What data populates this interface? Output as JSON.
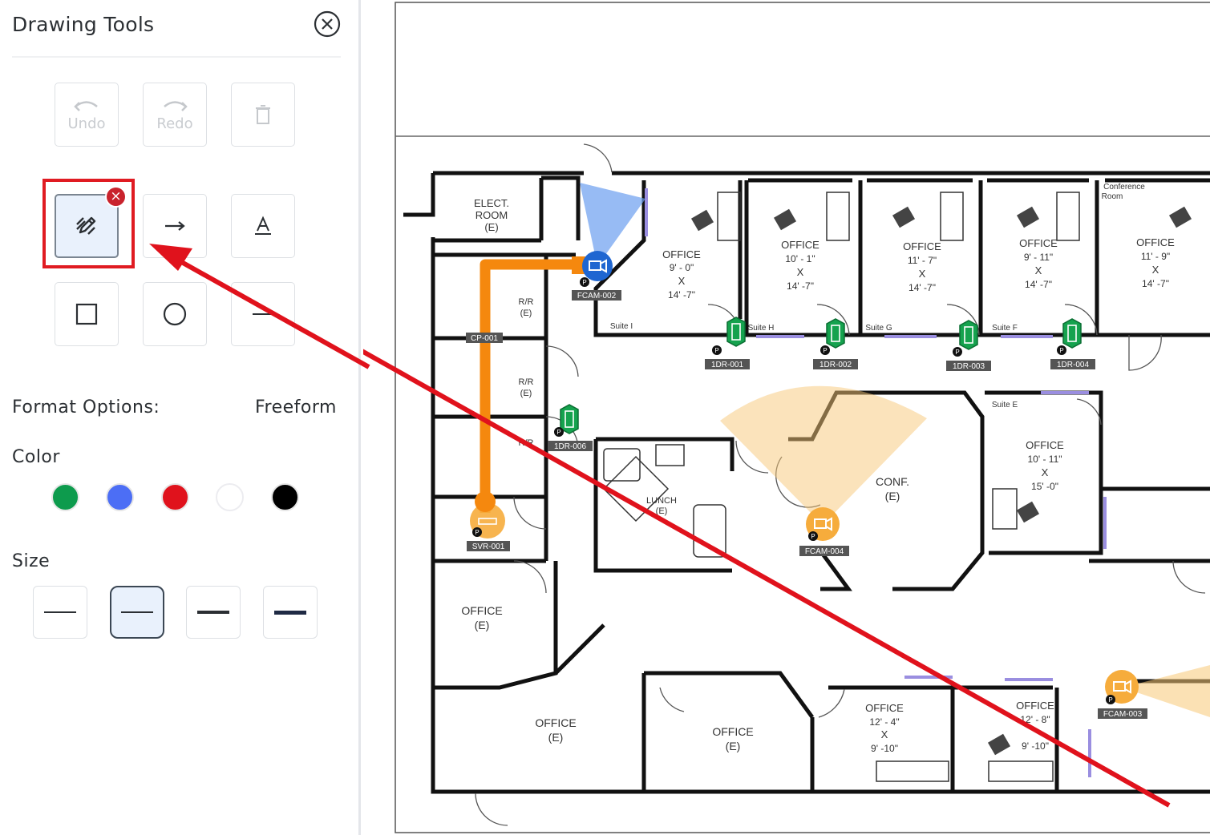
{
  "panel": {
    "title": "Drawing Tools",
    "undo_label": "Undo",
    "redo_label": "Redo",
    "format_label": "Format Options:",
    "format_value": "Freeform",
    "color_label": "Color",
    "size_label": "Size",
    "colors": [
      "#0d9b4d",
      "#4c6ef5",
      "#e0121c",
      "#ffffff",
      "#000000"
    ],
    "sizes": [
      "thin",
      "medium",
      "thick",
      "extra-thick"
    ],
    "selected_size": "medium",
    "selected_tool": "freeform"
  },
  "floorplan": {
    "rooms": {
      "elect": "ELECT.",
      "room": "ROOM",
      "e": "(E)",
      "office": "OFFICE",
      "conf": "CONF.",
      "lunch": "LUNCH",
      "rr": "R/R",
      "conference": "Conference",
      "room_small": "Room",
      "x": "X",
      "suite_i": "Suite I",
      "suite_h": "Suite H",
      "suite_g": "Suite G",
      "suite_f": "Suite F",
      "suite_e": "Suite E",
      "dim_a1": "9' - 0\"",
      "dim_a2": "14' -7\"",
      "dim_b1": "10' - 1\"",
      "dim_b2": "14' -7\"",
      "dim_c1": "11' - 7\"",
      "dim_c2": "14' -7\"",
      "dim_d1": "9' - 11\"",
      "dim_d2": "14' -7\"",
      "dim_e1": "11' - 9\"",
      "dim_e2": "14' -7\"",
      "dim_f1": "10' - 11\"",
      "dim_f2": "15' -0\"",
      "dim_g1": "12' - 4\"",
      "dim_g2": "9' -10\"",
      "dim_h1": "12' - 8\"",
      "dim_h2": "9' -10\""
    },
    "devices": {
      "fcam002": "FCAM-002",
      "fcam004": "FCAM-004",
      "fcam003": "FCAM-003",
      "cp001": "CP-001",
      "svr001": "SVR-001",
      "dr001": "1DR-001",
      "dr002": "1DR-002",
      "dr003": "1DR-003",
      "dr004": "1DR-004",
      "dr006": "1DR-006",
      "p": "P"
    }
  }
}
